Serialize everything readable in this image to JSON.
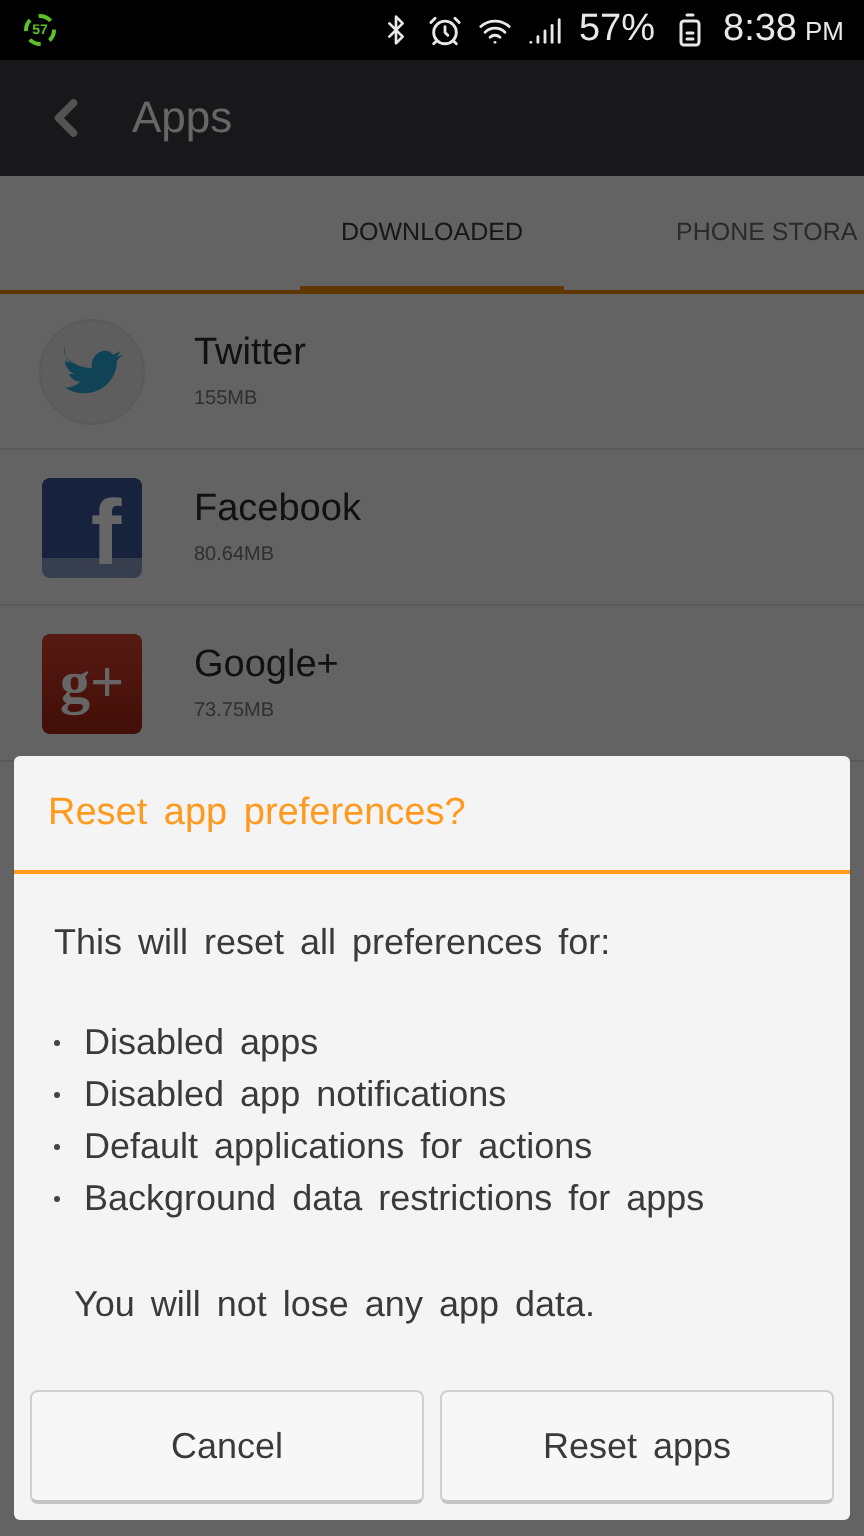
{
  "status_bar": {
    "badge": "57",
    "battery": "57%",
    "time": "8:38",
    "meridiem": "PM"
  },
  "toolbar": {
    "title": "Apps"
  },
  "tabs": [
    {
      "label": "DOWNLOADED",
      "selected": true
    },
    {
      "label": "PHONE STORA",
      "selected": false
    }
  ],
  "apps": [
    {
      "name": "Twitter",
      "size": "155MB",
      "kind": "twitter"
    },
    {
      "name": "Facebook",
      "size": "80.64MB",
      "kind": "facebook",
      "glyph": "f"
    },
    {
      "name": "Google+",
      "size": "73.75MB",
      "kind": "google",
      "glyph": "g+"
    }
  ],
  "dialog": {
    "title": "Reset app preferences?",
    "intro": "This will reset all preferences for:",
    "items": [
      "Disabled apps",
      "Disabled app notifications",
      "Default applications for actions",
      "Background data restrictions for apps"
    ],
    "note": "You will not lose any app data.",
    "buttons": [
      "Cancel",
      "Reset apps"
    ]
  }
}
